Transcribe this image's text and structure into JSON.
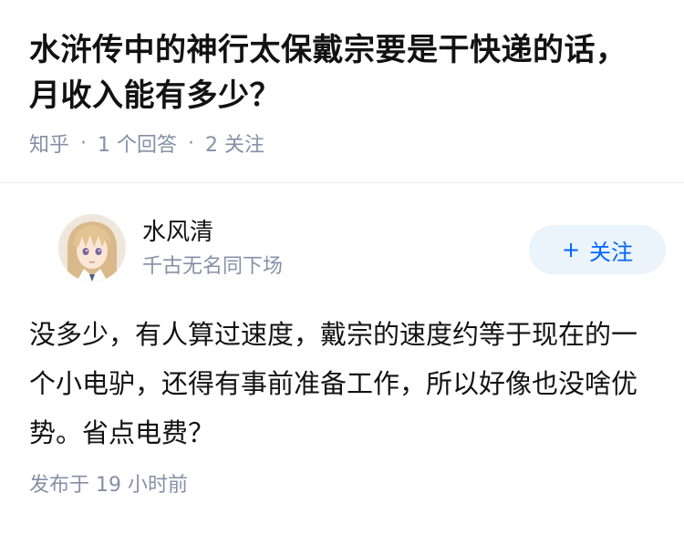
{
  "question": {
    "title": "水浒传中的神行太保戴宗要是干快递的话，月收入能有多少？",
    "source": "知乎",
    "answer_count": "1 个回答",
    "follower_count": "2 关注"
  },
  "answer": {
    "author_name": "水风清",
    "author_bio": "千古无名同下场",
    "follow_label": "关注",
    "content": "没多少，有人算过速度，戴宗的速度约等于现在的一个小电驴，还得有事前准备工作，所以好像也没啥优势。省点电费？",
    "published": "发布于  19 小时前"
  },
  "icons": {
    "follow": "plus-icon",
    "avatar": "anime-avatar"
  },
  "colors": {
    "title": "#121212",
    "meta": "#8590a6",
    "accent": "#0066ff",
    "follow_bg": "#ebf3fb"
  }
}
